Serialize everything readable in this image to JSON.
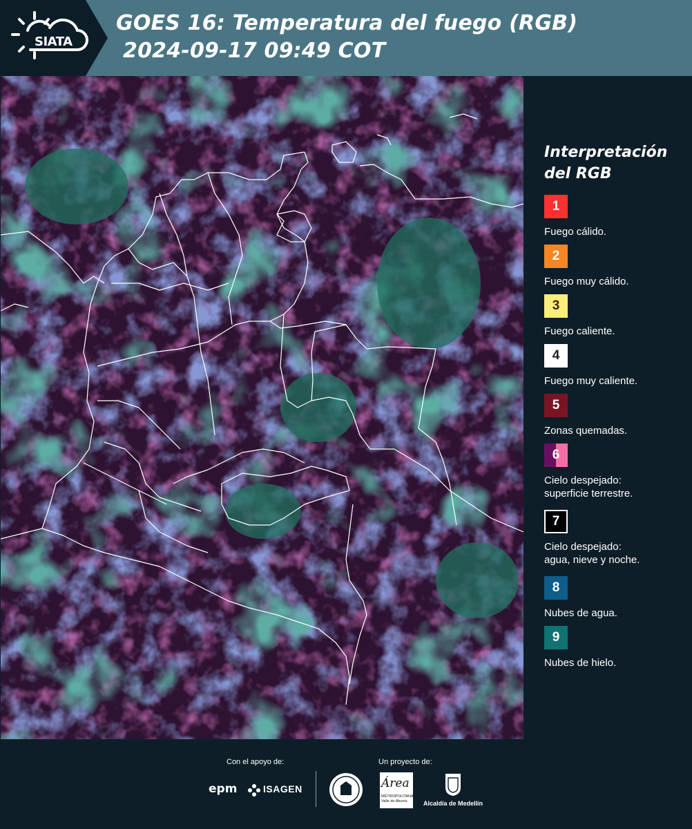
{
  "header": {
    "logo_text": "SIATA",
    "title_line1": "GOES 16: Temperatura del fuego (RGB)",
    "title_line2": "2024-09-17 09:49 COT",
    "bar_color": "#4a7584"
  },
  "map": {
    "icon": "satellite-rgb-map",
    "colors": {
      "land_burned": "#3a1430",
      "ice_clouds": "#1e6a5e",
      "water_clouds": "#3c4e9e",
      "borders": "#ffffff"
    }
  },
  "legend": {
    "title_line1": "Interpretación",
    "title_line2": "del RGB",
    "items": [
      {
        "number": "1",
        "color": "#ff3030",
        "line1": "Fuego cálido.",
        "line2": ""
      },
      {
        "number": "2",
        "color": "#f68624",
        "line1": "Fuego muy cálido.",
        "line2": ""
      },
      {
        "number": "3",
        "color": "#fdee7c",
        "line1": "Fuego caliente.",
        "line2": ""
      },
      {
        "number": "4",
        "color": "#ffffff",
        "line1": "Fuego muy caliente.",
        "line2": ""
      },
      {
        "number": "5",
        "color": "#7a1424",
        "line1": "Zonas quemadas.",
        "line2": ""
      },
      {
        "number": "6",
        "color": "#6a0f60",
        "color2": "#f26ea4",
        "line1": "Cielo despejado:",
        "line2": "superficie terrestre."
      },
      {
        "number": "7",
        "color": "#000000",
        "line1": "Cielo despejado:",
        "line2": "agua, nieve y noche."
      },
      {
        "number": "8",
        "color": "#0e5d8a",
        "line1": "Nubes de agua.",
        "line2": ""
      },
      {
        "number": "9",
        "color": "#0f7373",
        "line1": "Nubes de hielo.",
        "line2": ""
      }
    ]
  },
  "footer": {
    "support_label": "Con el apoyo de:",
    "project_label": "Un proyecto de:",
    "epm": "epm",
    "isagen": "ISAGEN",
    "area_name": "Área",
    "area_sub1": "METROPOLITANA",
    "area_sub2": "Valle de Aburrá",
    "alcaldia": "Alcaldía de Medellín"
  }
}
